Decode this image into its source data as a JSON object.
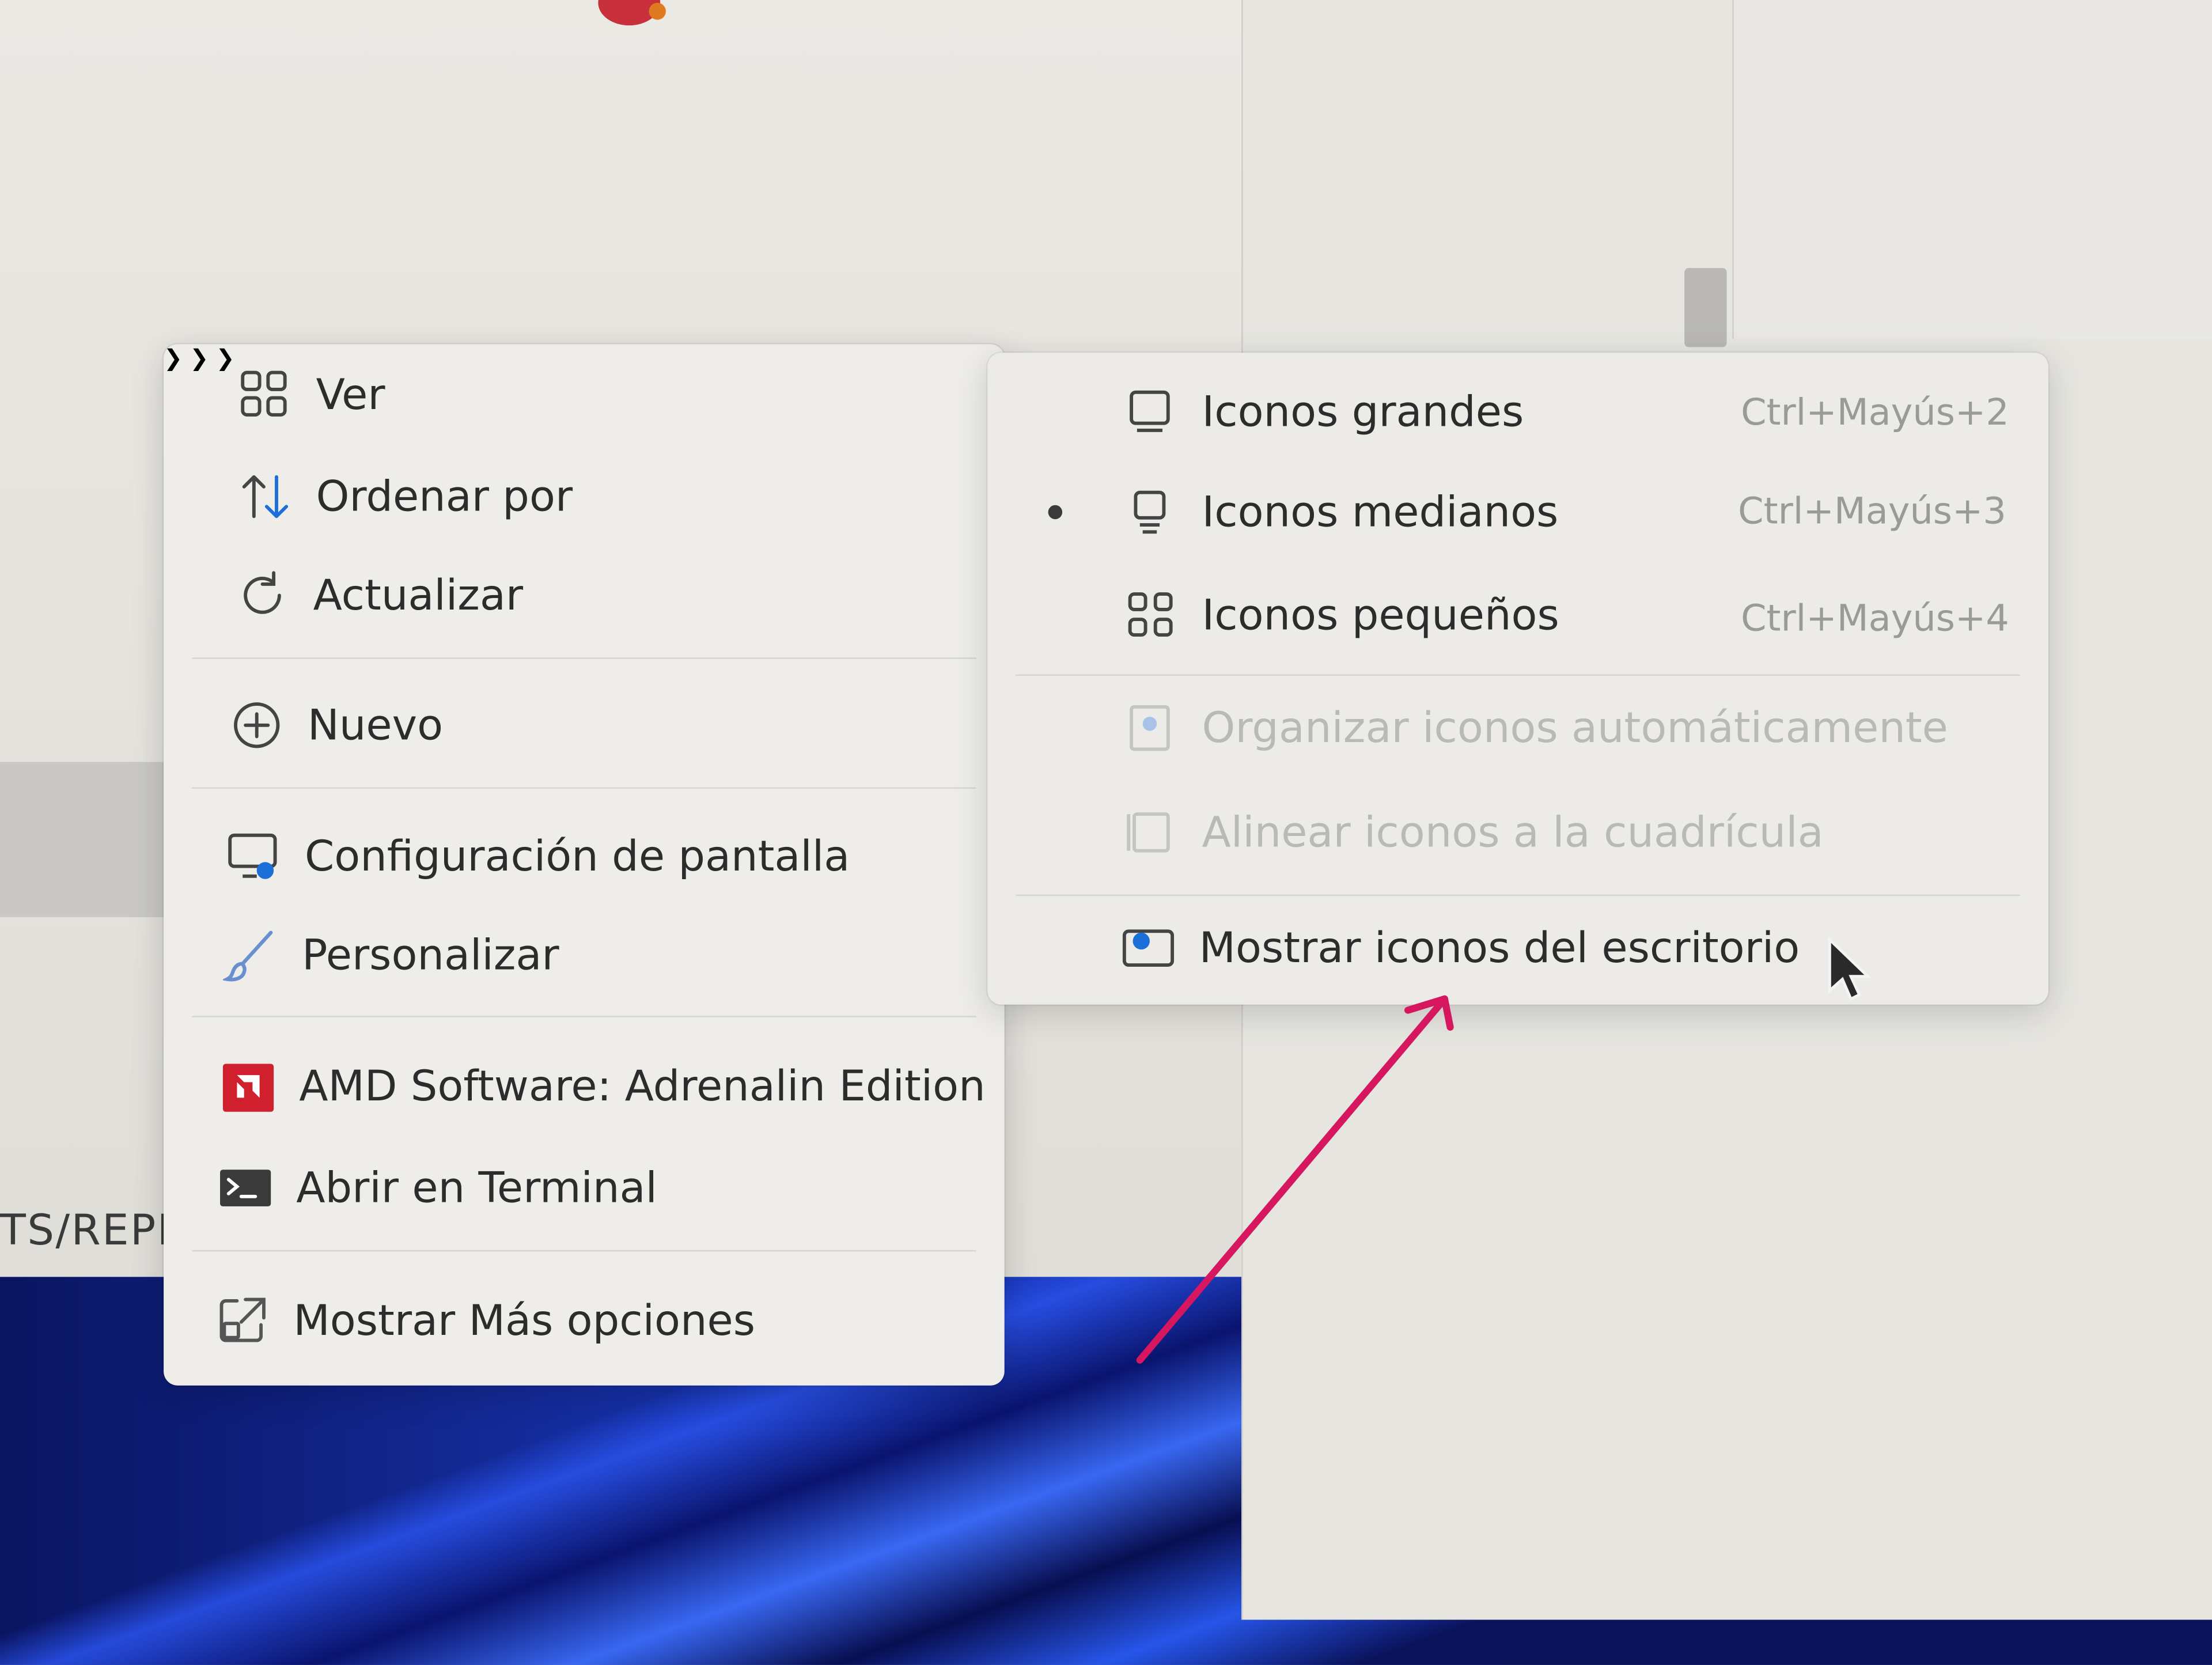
{
  "background": {
    "partial_text": "TS/REPI"
  },
  "menu": {
    "items": [
      {
        "label": "Ver",
        "icon": "grid-icon",
        "has_submenu": true
      },
      {
        "label": "Ordenar por",
        "icon": "sort-arrows-icon",
        "has_submenu": true
      },
      {
        "label": "Actualizar",
        "icon": "refresh-icon",
        "has_submenu": false
      },
      {
        "label": "Nuevo",
        "icon": "plus-circle-icon",
        "has_submenu": true
      },
      {
        "label": "Configuración de pantalla",
        "icon": "display-settings-icon",
        "has_submenu": false
      },
      {
        "label": "Personalizar",
        "icon": "brush-icon",
        "has_submenu": false
      },
      {
        "label": "AMD Software: Adrenalin Edition",
        "icon": "amd-logo-icon",
        "has_submenu": false
      },
      {
        "label": "Abrir en Terminal",
        "icon": "terminal-icon",
        "has_submenu": false
      },
      {
        "label": "Mostrar Más opciones",
        "icon": "more-options-icon",
        "has_submenu": false
      }
    ]
  },
  "submenu": {
    "items": [
      {
        "label": "Iconos grandes",
        "shortcut": "Ctrl+Mayús+2",
        "icon": "monitor-large-icon",
        "selected": false,
        "disabled": false
      },
      {
        "label": "Iconos medianos",
        "shortcut": "Ctrl+Mayús+3",
        "icon": "monitor-medium-icon",
        "selected": true,
        "disabled": false
      },
      {
        "label": "Iconos pequeños",
        "shortcut": "Ctrl+Mayús+4",
        "icon": "small-grid-icon",
        "selected": false,
        "disabled": false
      },
      {
        "label": "Organizar iconos automáticamente",
        "shortcut": "",
        "icon": "auto-arrange-icon",
        "selected": false,
        "disabled": true
      },
      {
        "label": "Alinear iconos a la cuadrícula",
        "shortcut": "",
        "icon": "align-grid-icon",
        "selected": false,
        "disabled": true
      },
      {
        "label": "Mostrar iconos del escritorio",
        "shortcut": "",
        "icon": "show-desktop-icons-icon",
        "selected": false,
        "disabled": false
      }
    ]
  },
  "colors": {
    "annotation_arrow": "#d6175f",
    "amd_red": "#d0202e",
    "accent_blue": "#1b6fd8"
  }
}
